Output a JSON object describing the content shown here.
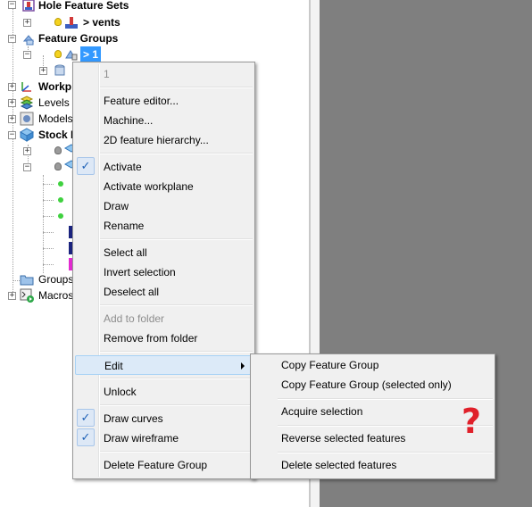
{
  "tree": {
    "hole_feature_sets": "Hole Feature Sets",
    "vents": "> vents",
    "feature_groups": "Feature Groups",
    "group_1": "> 1",
    "workplanes": "Workp",
    "levels": "Levels a",
    "models": "Models",
    "stock": "Stock I",
    "groups": "Groups",
    "macros": "Macros"
  },
  "menu": {
    "header": "1",
    "items": [
      {
        "label": "Feature editor..."
      },
      {
        "label": "Machine..."
      },
      {
        "label": "2D feature hierarchy..."
      },
      {
        "label": "Activate",
        "checked": true
      },
      {
        "label": "Activate workplane"
      },
      {
        "label": "Draw"
      },
      {
        "label": "Rename"
      },
      {
        "label": "Select all"
      },
      {
        "label": "Invert selection"
      },
      {
        "label": "Deselect all"
      },
      {
        "label": "Add to folder",
        "disabled": true
      },
      {
        "label": "Remove from folder"
      },
      {
        "label": "Edit",
        "submenu": true
      },
      {
        "label": "Unlock"
      },
      {
        "label": "Draw curves",
        "checked": true
      },
      {
        "label": "Draw wireframe",
        "checked": true
      },
      {
        "label": "Delete Feature Group"
      }
    ]
  },
  "submenu": {
    "items": [
      {
        "label": "Copy Feature Group"
      },
      {
        "label": "Copy Feature Group (selected only)"
      },
      {
        "label": "Acquire selection"
      },
      {
        "label": "Reverse selected features"
      },
      {
        "label": "Delete selected features"
      }
    ]
  },
  "annotation": {
    "question_mark": "?"
  },
  "check_glyph": "✓",
  "colors": {
    "viewport": "#7f7f7f",
    "selection": "#3399ff",
    "annotation": "#e0202a"
  }
}
